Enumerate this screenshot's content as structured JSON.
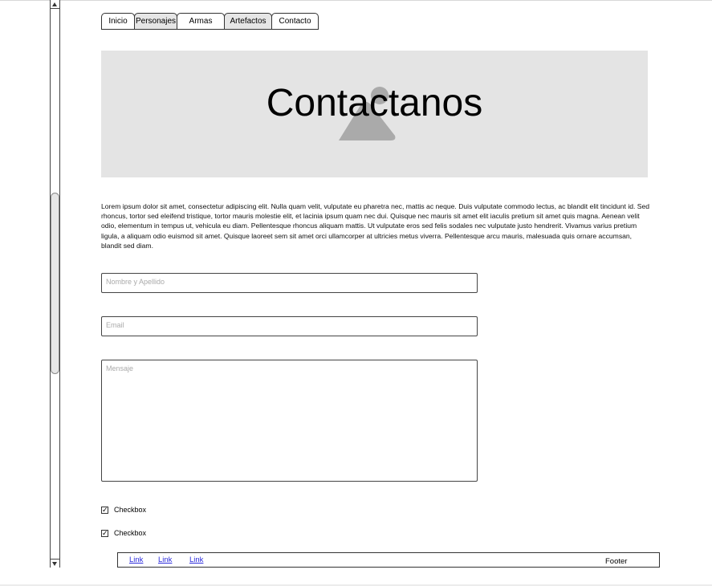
{
  "tabs": [
    {
      "label": "Inicio",
      "active": false
    },
    {
      "label": "Personajes",
      "active": true
    },
    {
      "label": "Armas",
      "active": false
    },
    {
      "label": "Artefactos",
      "active": true
    },
    {
      "label": "Contacto",
      "active": false
    }
  ],
  "hero": {
    "title": "Contactanos",
    "icon": "image-placeholder-icon"
  },
  "body_text": "Lorem ipsum dolor sit amet, consectetur adipiscing elit. Nulla quam velit, vulputate eu pharetra nec, mattis ac neque. Duis vulputate commodo lectus, ac blandit elit tincidunt id. Sed rhoncus, tortor sed eleifend tristique, tortor mauris molestie elit, et lacinia ipsum quam nec dui. Quisque nec mauris sit amet elit iaculis pretium sit amet quis magna. Aenean velit odio, elementum in tempus ut, vehicula eu diam. Pellentesque rhoncus aliquam mattis. Ut vulputate eros sed felis sodales nec vulputate justo hendrerit. Vivamus varius pretium ligula, a aliquam odio euismod sit amet. Quisque laoreet sem sit amet orci ullamcorper at ultricies metus viverra. Pellentesque arcu mauris, malesuada quis ornare accumsan, blandit sed diam.",
  "form": {
    "name_placeholder": "Nombre y Apellido",
    "email_placeholder": "Email",
    "message_placeholder": "Mensaje"
  },
  "checkboxes": [
    {
      "label": "Checkbox",
      "checked": true
    },
    {
      "label": "Checkbox",
      "checked": true
    }
  ],
  "footer": {
    "links": [
      "Link",
      "Link",
      "Link"
    ],
    "text": "Footer"
  },
  "colors": {
    "hero_bg": "#e4e4e4",
    "link": "#2a2adb",
    "active_tab": "#e6e6e6"
  }
}
